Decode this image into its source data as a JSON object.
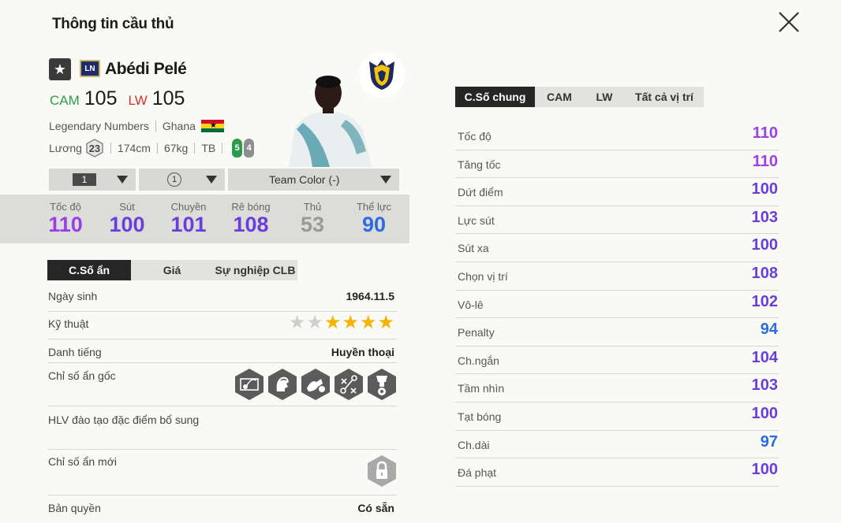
{
  "header": {
    "title": "Thông tin cầu thủ"
  },
  "player": {
    "name": "Abédi Pelé",
    "season_badge": "LN",
    "positions": [
      {
        "pos": "CAM",
        "ovr": "105"
      },
      {
        "pos": "LW",
        "ovr": "105"
      }
    ],
    "card_type": "Legendary Numbers",
    "nation": "Ghana",
    "salary_label": "Lương",
    "salary": "23",
    "height": "174cm",
    "weight": "67kg",
    "body_type": "TB",
    "left_foot": "5",
    "right_foot": "4"
  },
  "dropdowns": {
    "level": "1",
    "grade": "1",
    "team_color": "Team Color (-)"
  },
  "summary_stats": [
    {
      "label": "Tốc độ",
      "value": "110",
      "color": "#9b3fe6"
    },
    {
      "label": "Sút",
      "value": "100",
      "color": "#6a3ed8"
    },
    {
      "label": "Chuyền",
      "value": "101",
      "color": "#6a3ed8"
    },
    {
      "label": "Rê bóng",
      "value": "108",
      "color": "#6a3ed8"
    },
    {
      "label": "Thủ",
      "value": "53",
      "color": "#999999"
    },
    {
      "label": "Thể lực",
      "value": "90",
      "color": "#2f6be0"
    }
  ],
  "left_tabs": [
    "C.Số ẩn",
    "Giá",
    "Sự nghiệp CLB"
  ],
  "details": {
    "birthday_label": "Ngày sinh",
    "birthday": "1964.11.5",
    "skill_label": "Kỹ thuật",
    "skill_stars": 4,
    "reputation_label": "Danh tiếng",
    "reputation": "Huyền thoại",
    "traits_label": "Chỉ số ẩn gốc",
    "coach_label": "HLV đào tạo đặc điểm bổ sung",
    "new_traits_label": "Chỉ số ẩn mới",
    "copyright_label": "Bản quyền",
    "copyright": "Có sẵn"
  },
  "right_tabs": [
    "C.Số chung",
    "CAM",
    "LW",
    "Tất cả vị trí"
  ],
  "stats": [
    {
      "label": "Tốc độ",
      "value": "110",
      "color": "#9b3fe6"
    },
    {
      "label": "Tăng tốc",
      "value": "110",
      "color": "#9b3fe6"
    },
    {
      "label": "Dứt điểm",
      "value": "100",
      "color": "#6a3ed8"
    },
    {
      "label": "Lực sút",
      "value": "103",
      "color": "#6a3ed8"
    },
    {
      "label": "Sút xa",
      "value": "100",
      "color": "#6a3ed8"
    },
    {
      "label": "Chọn vị trí",
      "value": "108",
      "color": "#6a3ed8"
    },
    {
      "label": "Vô-lê",
      "value": "102",
      "color": "#6a3ed8"
    },
    {
      "label": "Penalty",
      "value": "94",
      "color": "#2f6be0"
    },
    {
      "label": "Ch.ngắn",
      "value": "104",
      "color": "#6a3ed8"
    },
    {
      "label": "Tầm nhìn",
      "value": "103",
      "color": "#6a3ed8"
    },
    {
      "label": "Tạt bóng",
      "value": "100",
      "color": "#6a3ed8"
    },
    {
      "label": "Ch.dài",
      "value": "97",
      "color": "#2f6be0"
    },
    {
      "label": "Đá phạt",
      "value": "100",
      "color": "#6a3ed8"
    }
  ]
}
